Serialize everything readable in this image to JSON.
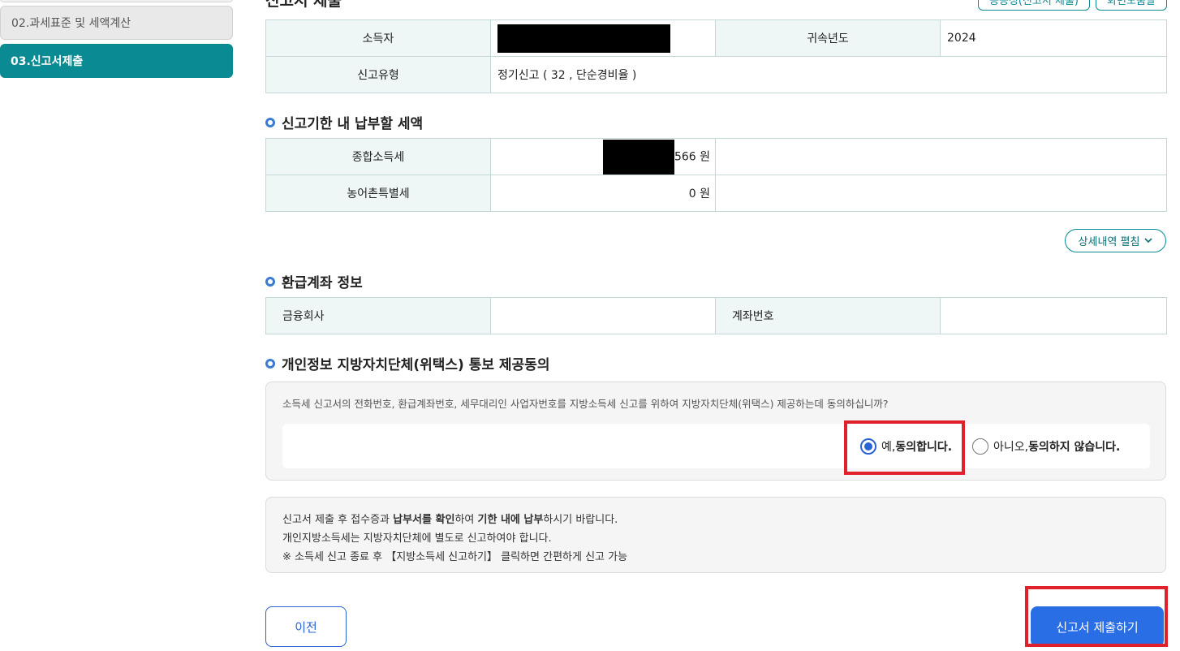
{
  "sidebar": {
    "items": [
      {
        "label": "02.과세표준 및 세액계산"
      },
      {
        "label": "03.신고서제출"
      }
    ]
  },
  "header": {
    "title": "신고서 제출",
    "btn1": "공공성(신고서 제출)",
    "btn2": "화면도움말"
  },
  "filing_table": {
    "taxpayer_label": "소득자",
    "year_label": "귀속년도",
    "year_value": "2024",
    "type_label": "신고유형",
    "type_value": "정기신고 ( 32 , 단순경비율 )"
  },
  "tax_section": {
    "title": "신고기한 내 납부할 세액",
    "rows": [
      {
        "label": "종합소득세",
        "value": "566 원"
      },
      {
        "label": "농어촌특별세",
        "value": "0 원"
      }
    ],
    "detail_button": "상세내역 펼침",
    "detail_icon": "chevron-down-icon"
  },
  "refund_section": {
    "title": "환급계좌 정보",
    "bank_label": "금융회사",
    "bank_value": "",
    "account_label": "계좌번호",
    "account_value": ""
  },
  "consent_section": {
    "title": "개인정보 지방자치단체(위택스) 통보 제공동의",
    "question": "소득세 신고서의 전화번호, 환급계좌번호, 세무대리인 사업자번호를 지방소득세 신고를 위하여 지방자치단체(위택스) 제공하는데 동의하십니까?",
    "yes_prefix": "예, ",
    "yes_bold": "동의합니다.",
    "no_prefix": "아니오, ",
    "no_bold": "동의하지 않습니다.",
    "selected": "yes"
  },
  "notice": {
    "line1_a": "신고서 제출 후 접수증과 ",
    "line1_b": "납부서를 확인",
    "line1_c": "하여 ",
    "line1_d": "기한 내에 납부",
    "line1_e": "하시기 바랍니다.",
    "line2": "개인지방소득세는 지방자치단체에 별도로 신고하여야 합니다.",
    "line3": "※ 소득세 신고 종료 후 【지방소득세 신고하기】 클릭하면 간편하게 신고 가능"
  },
  "buttons": {
    "prev": "이전",
    "submit": "신고서 제출하기"
  },
  "colors": {
    "teal": "#0a8a93",
    "blue": "#2a6ee6",
    "highlight_red": "#e0212b"
  }
}
